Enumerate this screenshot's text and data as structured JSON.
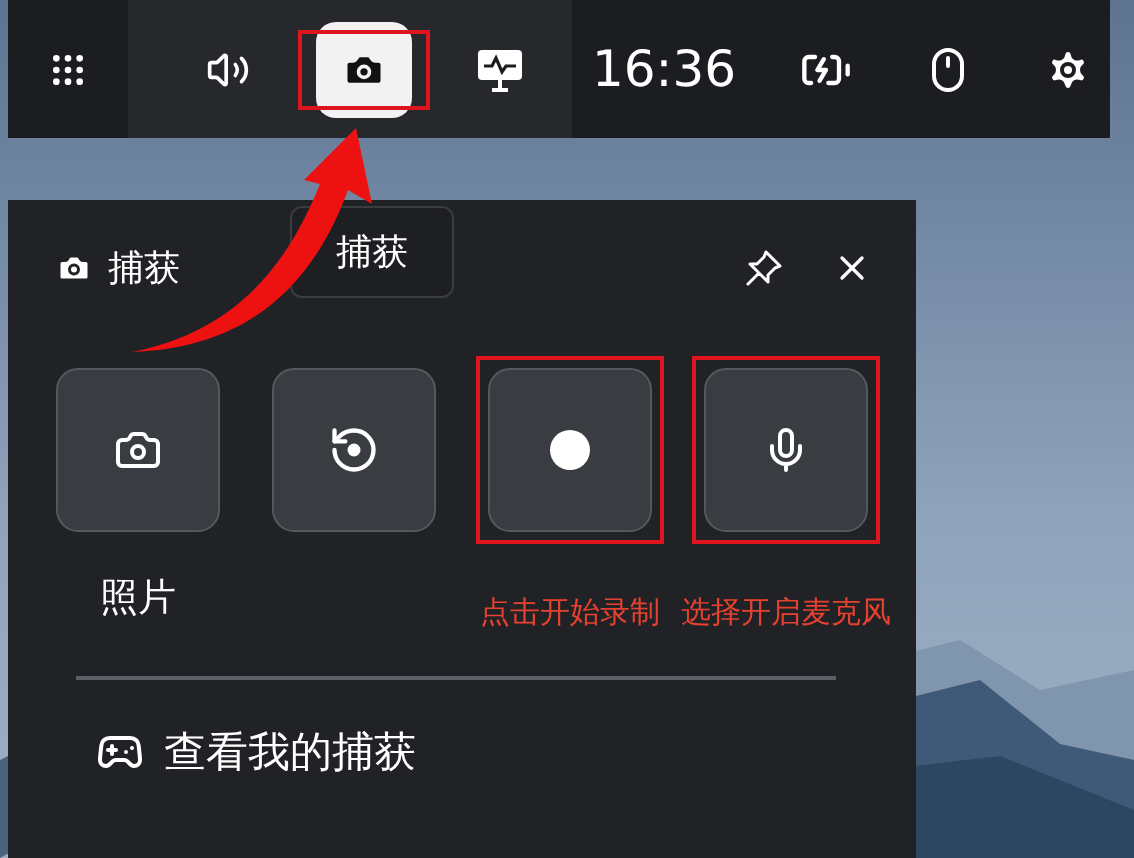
{
  "top_bar": {
    "items": [
      {
        "kind": "widgets",
        "selected": false
      },
      {
        "kind": "audio",
        "selected": false
      },
      {
        "kind": "capture",
        "selected": true,
        "annotated": true
      },
      {
        "kind": "performance",
        "selected": false
      }
    ],
    "time": "16:36",
    "status": [
      {
        "kind": "battery"
      },
      {
        "kind": "mouse"
      },
      {
        "kind": "settings"
      }
    ]
  },
  "tooltip": {
    "text": "捕获"
  },
  "capture_panel": {
    "title": "捕获",
    "buttons": [
      {
        "kind": "screenshot",
        "annotated": false
      },
      {
        "kind": "record_last",
        "annotated": false
      },
      {
        "kind": "record",
        "annotated": true,
        "note": "点击开始录制"
      },
      {
        "kind": "microphone",
        "annotated": true,
        "note": "选择开启麦克风"
      }
    ],
    "caption": "照片",
    "link": "查看我的捕获"
  }
}
